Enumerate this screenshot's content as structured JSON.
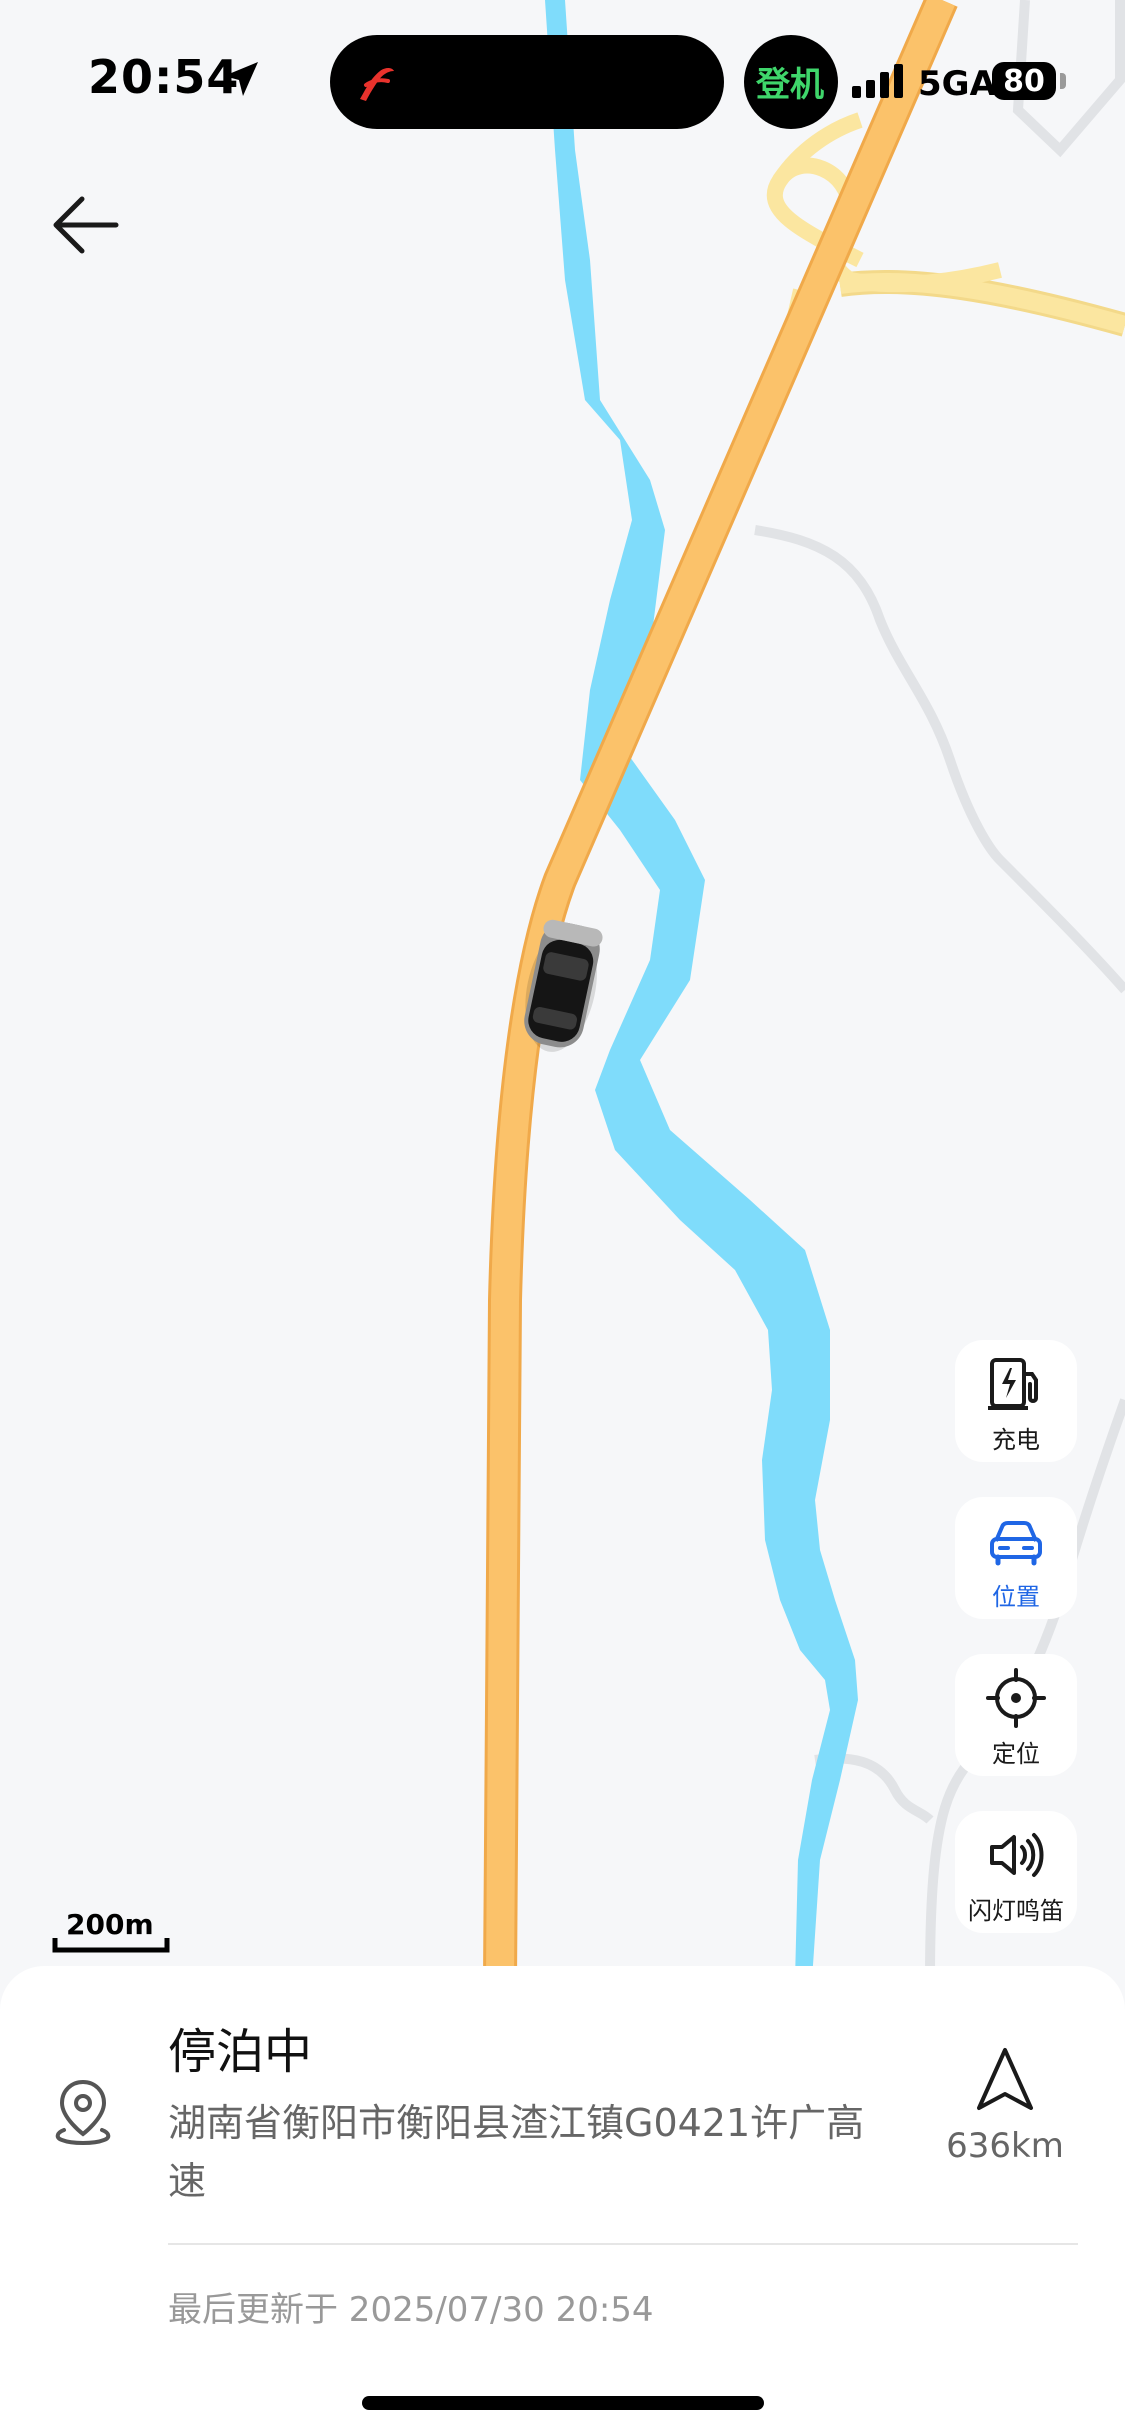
{
  "status_bar": {
    "time": "20:54",
    "boarding_badge": "登机",
    "network": "5GA",
    "battery": "80"
  },
  "map": {
    "scale_label": "200m",
    "colors": {
      "background": "#f6f7f9",
      "highway": "#fbc26a",
      "highway_edge": "#f0a94a",
      "ramp": "#fbe6a0",
      "river": "#7fdcfb",
      "minor_road": "#e1e3e6"
    }
  },
  "side_controls": {
    "charge": {
      "label": "充电",
      "icon": "charging-station-icon"
    },
    "position": {
      "label": "位置",
      "icon": "car-icon",
      "active": true,
      "color": "#1f66e5"
    },
    "locate": {
      "label": "定位",
      "icon": "crosshair-icon"
    },
    "flash_horn": {
      "label": "闪灯鸣笛",
      "icon": "speaker-icon"
    }
  },
  "sheet": {
    "status": "停泊中",
    "address": "湖南省衡阳市衡阳县渣江镇G0421许广高速",
    "distance": "636km",
    "last_updated": "最后更新于 2025/07/30 20:54"
  }
}
